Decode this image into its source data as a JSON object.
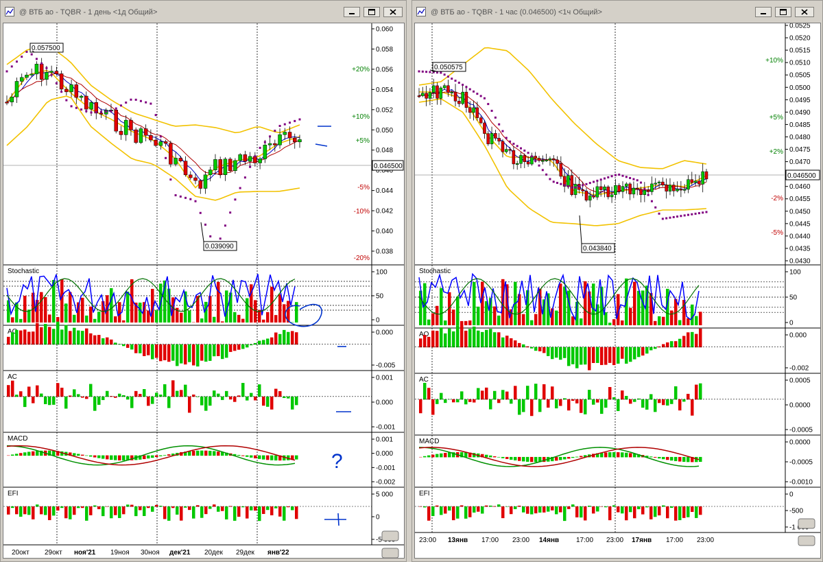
{
  "windows": [
    {
      "title": "@ ВТБ ао - TQBR - 1 день <1д Общий>",
      "price_axis": [
        "0.060",
        "0.058",
        "0.056",
        "0.054",
        "0.052",
        "0.050",
        "0.048",
        "0.046",
        "0.044",
        "0.042",
        "0.040",
        "0.038"
      ],
      "pct_labels": [
        {
          "text": "+20%",
          "color": "#008000"
        },
        {
          "text": "+10%",
          "color": "#008000"
        },
        {
          "text": "+5%",
          "color": "#008000"
        },
        {
          "text": "-5%",
          "color": "#c00000"
        },
        {
          "text": "-10%",
          "color": "#c00000"
        },
        {
          "text": "-20%",
          "color": "#c00000"
        }
      ],
      "current_price": "0.046500",
      "high_label": "0.057500",
      "low_label": "0.039090",
      "panels": [
        {
          "name": "Stochastic",
          "ticks": [
            "100",
            "50",
            "0"
          ]
        },
        {
          "name": "AO",
          "ticks": [
            "0.000",
            "-0.005"
          ]
        },
        {
          "name": "AC",
          "ticks": [
            "0.001",
            "0.000",
            "-0.001"
          ]
        },
        {
          "name": "MACD",
          "ticks": [
            "0.001",
            "0.000",
            "-0.001",
            "-0.002"
          ]
        },
        {
          "name": "EFI",
          "ticks": [
            "5 000",
            "0",
            "-5 000"
          ]
        }
      ],
      "time_axis": [
        {
          "text": "20окт",
          "bold": false
        },
        {
          "text": "29окт",
          "bold": false
        },
        {
          "text": "ноя'21",
          "bold": true
        },
        {
          "text": "19ноя",
          "bold": false
        },
        {
          "text": "30ноя",
          "bold": false
        },
        {
          "text": "дек'21",
          "bold": true
        },
        {
          "text": "20дек",
          "bold": false
        },
        {
          "text": "29дек",
          "bold": false
        },
        {
          "text": "янв'22",
          "bold": true
        }
      ],
      "annotation_question": "?"
    },
    {
      "title": "@ ВТБ ао - TQBR - 1 час (0.046500) <1ч Общий>",
      "price_axis": [
        "0.0525",
        "0.0520",
        "0.0515",
        "0.0510",
        "0.0505",
        "0.0500",
        "0.0495",
        "0.0490",
        "0.0485",
        "0.0480",
        "0.0475",
        "0.0470",
        "0.0465",
        "0.0460",
        "0.0455",
        "0.0450",
        "0.0445",
        "0.0440",
        "0.0435",
        "0.0430"
      ],
      "pct_labels": [
        {
          "text": "+10%",
          "color": "#008000"
        },
        {
          "text": "+5%",
          "color": "#008000"
        },
        {
          "text": "+2%",
          "color": "#008000"
        },
        {
          "text": "-2%",
          "color": "#c00000"
        },
        {
          "text": "-5%",
          "color": "#c00000"
        }
      ],
      "current_price": "0.046500",
      "high_label": "0.050575",
      "low_label": "0.043840",
      "panels": [
        {
          "name": "Stochastic",
          "ticks": [
            "100",
            "50",
            "0"
          ]
        },
        {
          "name": "AO",
          "ticks": [
            "0.000",
            "-0.002"
          ]
        },
        {
          "name": "AC",
          "ticks": [
            "0.0005",
            "0.0000",
            "-0.0005"
          ]
        },
        {
          "name": "MACD",
          "ticks": [
            "0.0000",
            "-0.0005",
            "-0.0010"
          ]
        },
        {
          "name": "EFI",
          "ticks": [
            "0",
            "-500",
            "-1 000"
          ]
        }
      ],
      "time_axis": [
        {
          "text": "23:00",
          "bold": false
        },
        {
          "text": "13янв",
          "bold": true
        },
        {
          "text": "17:00",
          "bold": false
        },
        {
          "text": "23:00",
          "bold": false
        },
        {
          "text": "14янв",
          "bold": true
        },
        {
          "text": "17:00",
          "bold": false
        },
        {
          "text": "23:00",
          "bold": false
        },
        {
          "text": "17янв",
          "bold": true
        },
        {
          "text": "17:00",
          "bold": false
        },
        {
          "text": "23:00",
          "bold": false
        }
      ],
      "annotation_question": ""
    }
  ],
  "colors": {
    "bull": "#00c800",
    "bear": "#e00000",
    "bollinger": "#f2c200",
    "sar": "#800080",
    "ma_fast": "#0000c0",
    "ma_slow": "#b00000",
    "stoch_k": "#0000ff",
    "stoch_d": "#007000",
    "annotation": "#0033cc"
  },
  "icons": {
    "minimize": "minimize-icon",
    "maximize": "maximize-icon",
    "close": "close-icon",
    "app": "chart-window-icon"
  }
}
